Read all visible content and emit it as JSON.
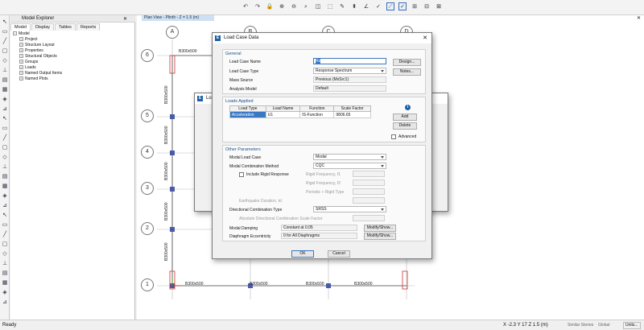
{
  "explorer": {
    "title": "Model Explorer",
    "tabs": [
      "Model",
      "Display",
      "Tables",
      "Reports"
    ],
    "tree": [
      {
        "label": "Model",
        "depth": 0
      },
      {
        "label": "Project",
        "depth": 1
      },
      {
        "label": "Structure Layout",
        "depth": 1
      },
      {
        "label": "Properties",
        "depth": 1
      },
      {
        "label": "Structural Objects",
        "depth": 1
      },
      {
        "label": "Groups",
        "depth": 1
      },
      {
        "label": "Loads",
        "depth": 1
      },
      {
        "label": "Named Output Items",
        "depth": 1
      },
      {
        "label": "Named Plots",
        "depth": 1
      }
    ]
  },
  "plan": {
    "tab_title": "Plan View - Plinth - Z = 1.5 (m)",
    "col_bubbles": [
      "A",
      "B",
      "C",
      "D"
    ],
    "row_bubbles": [
      "6",
      "5",
      "4",
      "3",
      "2",
      "1"
    ],
    "beam_labels_h": [
      "B300x500",
      "B300x500",
      "B300x500",
      "B300x500",
      "B300x500",
      "B300x500"
    ],
    "beam_labels_v": [
      "B300x500",
      "B300x500",
      "B300x500",
      "B300x500",
      "B300x500",
      "B300x500",
      "B300x500"
    ]
  },
  "dialog": {
    "title": "Load Case Data",
    "general_header": "General",
    "load_case_name_label": "Load Case Name",
    "load_case_name_value": "Rs",
    "load_case_type_label": "Load Case Type",
    "load_case_type_value": "Response Spectrum",
    "mass_source_label": "Mass Source",
    "mass_source_value": "Previous (MsSrc1)",
    "analysis_model_label": "Analysis Model",
    "analysis_model_value": "Default",
    "design_btn": "Design...",
    "notes_btn": "Notes...",
    "loads_header": "Loads Applied",
    "loads_columns": [
      "Load Type",
      "Load Name",
      "Function",
      "Scale Factor"
    ],
    "loads_rows": [
      [
        "Acceleration",
        "U1",
        "IS-Function",
        "9806.65"
      ]
    ],
    "add_btn": "Add",
    "delete_btn": "Delete",
    "advanced_label": "Advanced",
    "other_header": "Other Parameters",
    "modal_case_label": "Modal Load Case",
    "modal_case_value": "Modal",
    "modal_comb_label": "Modal Combination Method",
    "modal_comb_value": "CQC",
    "rigid_resp_label": "Include Rigid Response",
    "rigid_f1_label": "Rigid Frequency, f1",
    "rigid_f2_label": "Rigid Frequency, f2",
    "periodic_label": "Periodic + Rigid Type",
    "eq_duration_label": "Earthquake Duration, td",
    "dir_comb_label": "Directional Combination Type",
    "dir_comb_value": "SRSS",
    "abs_scale_label": "Absolute Directional Combination Scale Factor",
    "damping_label": "Modal Damping",
    "damping_value": "Constant at 0.05",
    "eccentricity_label": "Diaphragm Eccentricity",
    "eccentricity_value": "0 for All Diaphragms",
    "modify_btn": "Modify/Show...",
    "ok_btn": "OK",
    "cancel_btn": "Cancel"
  },
  "back_dialog": {
    "title": "Load"
  },
  "status": {
    "left": "Ready",
    "coords": "X -2.3  Y 17  Z 1.5 (m)",
    "stories": "Similar Stories",
    "global": "Global",
    "units": "Units..."
  }
}
